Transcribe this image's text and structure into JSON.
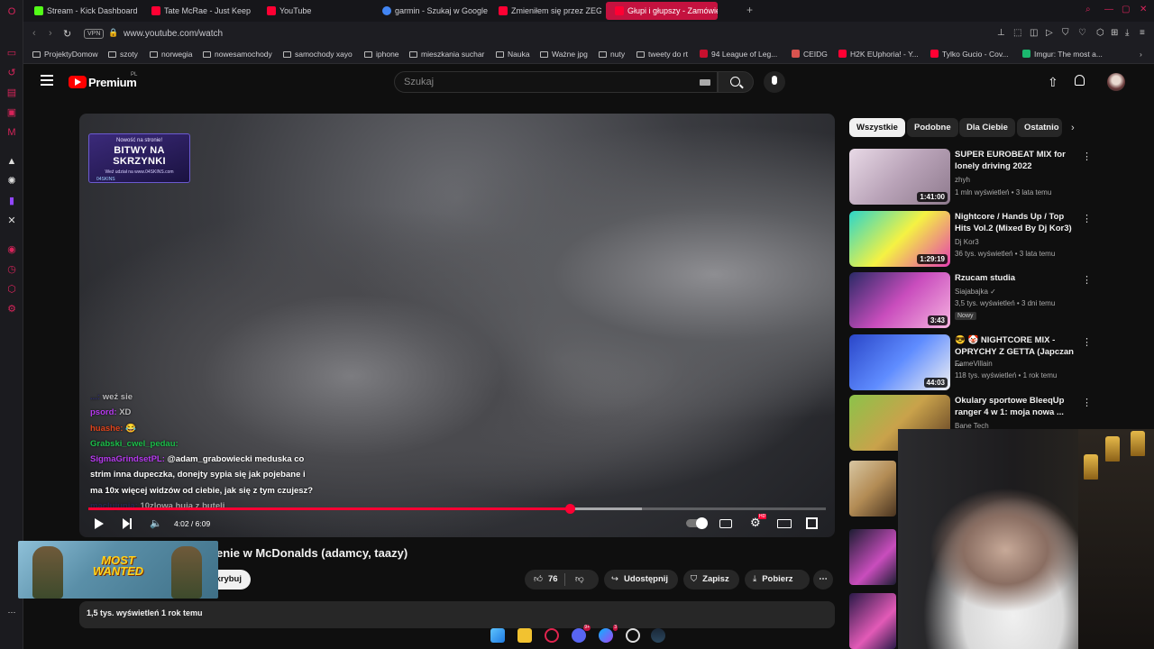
{
  "browser": {
    "tabs": [
      {
        "label": "Stream - Kick Dashboard",
        "favicon_color": "#53fc18"
      },
      {
        "label": "Tate McRae - Just Keep W",
        "favicon_color": "#ff0033"
      },
      {
        "label": "YouTube",
        "favicon_color": "#ff0033"
      },
      {
        "label": "garmin - Szukaj w Google",
        "favicon_color": "#4285f4"
      },
      {
        "label": "Zmieniłem się przez ZEG",
        "favicon_color": "#ff0033"
      },
      {
        "label": "Głupi i głupszy - Zamówie",
        "favicon_color": "#ff0033"
      }
    ],
    "new_tab_label": "+",
    "vpn_label": "VPN",
    "url": "www.youtube.com/watch",
    "bookmarks": [
      "ProjektyDomow",
      "szoty",
      "norwegia",
      "nowesamochody",
      "samochody xayo",
      "iphone",
      "mieszkania suchar",
      "Nauka",
      "Ważne jpg",
      "nuty",
      "tweety do rt",
      "94 League of Leg...",
      "CEIDG",
      "H2K EUphoria! - Y...",
      "Tylko Gucio - Cov...",
      "Imgur: The most a..."
    ]
  },
  "youtube": {
    "brand": "Premium",
    "region": "PL",
    "search_placeholder": "Szukaj"
  },
  "player": {
    "promo": {
      "line1": "Nowość na stronie!",
      "line2": "BITWY NA SKRZYNKI",
      "line3": "Weź udział na www.04SKINS.com",
      "line4": "04SKINS"
    },
    "chat": [
      {
        "user": "...:",
        "msg": "weź sie"
      },
      {
        "user": "psord:",
        "msg": "XD"
      },
      {
        "user": "huashe:",
        "msg": "😂"
      },
      {
        "user": "Grabski_cwel_pedau:",
        "msg": ""
      },
      {
        "user": "SigmaGrindsetPL:",
        "msg": "@adam_grabowiecki meduska co"
      },
      {
        "user": "",
        "msg": "strim inna dupeczka, donejty sypia się jak pojebane i"
      },
      {
        "user": "",
        "msg": "ma 10x więcej widzów od ciebie, jak się z tym czujesz?"
      },
      {
        "user": "maclujunia:",
        "msg": "10zlowa huja z buteli"
      }
    ],
    "time_current": "4:02",
    "time_total": "6:09",
    "progress_fraction": 0.653,
    "buffer_fraction": 0.75,
    "hd_badge": "HD"
  },
  "video": {
    "title": "enie w McDonalds (adamcy, taazy)",
    "subscribe_label": "krybuj",
    "likes": "76",
    "share_label": "Udostępnij",
    "save_label": "Zapisz",
    "download_label": "Pobierz",
    "views_date": "1,5 tys. wyświetleń  1 rok temu"
  },
  "mini_player": {
    "label": "MOST WANTED"
  },
  "chips": [
    "Wszystkie",
    "Podobne",
    "Dla Ciebie",
    "Ostatnio"
  ],
  "recommendations": [
    {
      "title": "SUPER EUROBEAT MIX for lonely driving 2022",
      "channel": "zhyh",
      "meta": "1 mln wyświetleń • 3 lata temu",
      "duration": "1:41:00",
      "badge": "",
      "thumb_bg": "linear-gradient(135deg,#e8d9e6,#b9a3b8 50%,#8e7a8d)"
    },
    {
      "title": "Nightcore / Hands Up / Top Hits Vol.2 (Mixed By Dj Kor3)",
      "channel": "Dj Kor3",
      "meta": "36 tys. wyświetleń • 3 lata temu",
      "duration": "1:29:19",
      "badge": "",
      "thumb_bg": "linear-gradient(135deg,#2bd6c9,#f5f243 50%,#e53fb0)"
    },
    {
      "title": "Rzucam studia",
      "channel": "Siajabajka",
      "meta": "3,5 tys. wyświetleń • 3 dni temu",
      "duration": "3:43",
      "badge": "Nowy",
      "thumb_bg": "linear-gradient(135deg,#2a2a66,#c94dbd 50%,#f6b3e0)"
    },
    {
      "title": "😎 🤡 NIGHTCORE MIX - OPRYCHY Z GETTA (Japczan ...",
      "channel": "FameVillain",
      "meta": "118 tys. wyświetleń • 1 rok temu",
      "duration": "44:03",
      "badge": "",
      "thumb_bg": "linear-gradient(135deg,#2a46c8,#5f8cff 50%,#f2f2f2)"
    },
    {
      "title": "Okulary sportowe BleeqUp ranger 4 w 1: moja nowa ...",
      "channel": "Bane Tech",
      "meta": "",
      "duration": "",
      "badge": "",
      "thumb_bg": "linear-gradient(135deg,#8bc34a,#c9a24b 50%,#5a3a22)"
    }
  ]
}
